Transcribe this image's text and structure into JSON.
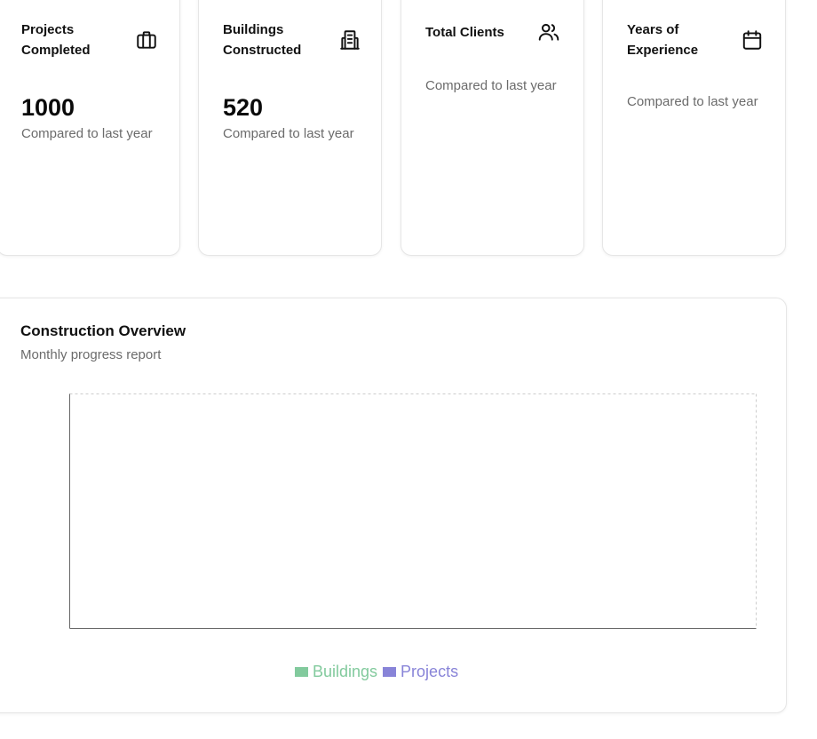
{
  "stats": [
    {
      "title": "Projects Completed",
      "value": "1000",
      "note": "Compared to last year",
      "icon": "briefcase-icon"
    },
    {
      "title": "Buildings Constructed",
      "value": "520",
      "note": "Compared to last year",
      "icon": "building-icon"
    },
    {
      "title": "Total Clients",
      "value": "",
      "note": "Compared to last year",
      "icon": "users-icon"
    },
    {
      "title": "Years of Experience",
      "value": "",
      "note": "Compared to last year",
      "icon": "calendar-icon"
    }
  ],
  "overview": {
    "title": "Construction Overview",
    "subtitle": "Monthly progress report"
  },
  "chart_data": {
    "type": "bar",
    "categories": [],
    "series": [
      {
        "name": "Buildings",
        "values": [],
        "color": "#82ca9d"
      },
      {
        "name": "Projects",
        "values": [],
        "color": "#8884d8"
      }
    ],
    "grid": true,
    "legend": "bottom-center"
  }
}
